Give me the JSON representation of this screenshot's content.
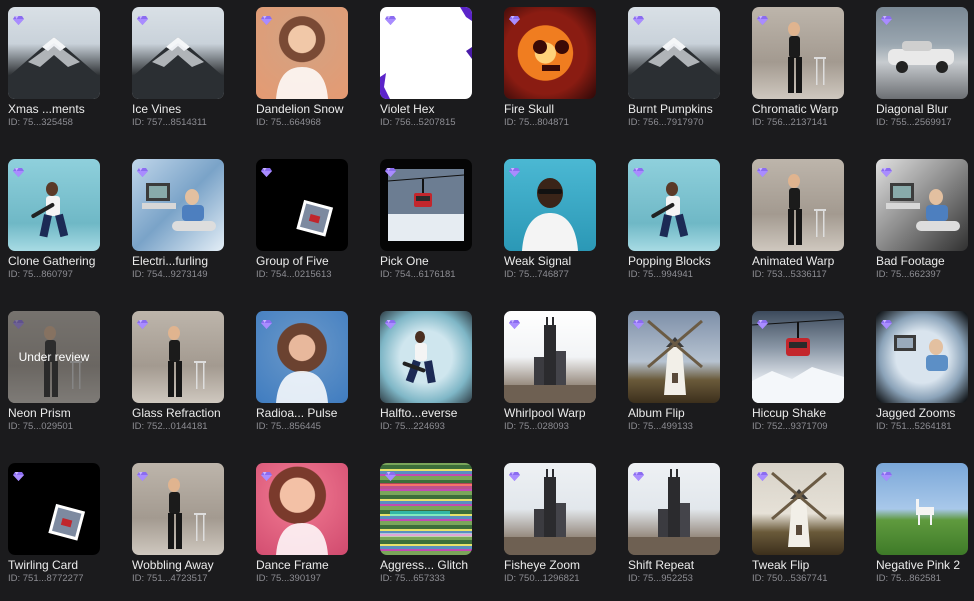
{
  "badge_color": "#8b6cf0",
  "items": [
    {
      "title": "Xmas ...ments",
      "id": "ID: 75...325458",
      "art": "mountain",
      "review": ""
    },
    {
      "title": "Ice Vines",
      "id": "ID: 757...8514311",
      "art": "mountain",
      "review": ""
    },
    {
      "title": "Dandelion Snow",
      "id": "ID: 75...664968",
      "art": "portrait",
      "review": ""
    },
    {
      "title": "Violet Hex",
      "id": "ID: 756...5207815",
      "art": "violet",
      "review": ""
    },
    {
      "title": "Fire Skull",
      "id": "ID: 75...804871",
      "art": "fire",
      "review": ""
    },
    {
      "title": "Burnt Pumpkins",
      "id": "ID: 756...7917970",
      "art": "mountain",
      "review": ""
    },
    {
      "title": "Chromatic Warp",
      "id": "ID: 756...2137141",
      "art": "studio",
      "review": ""
    },
    {
      "title": "Diagonal Blur",
      "id": "ID: 755...2569917",
      "art": "car",
      "review": ""
    },
    {
      "title": "Clone Gathering",
      "id": "ID: 75...860797",
      "art": "teal",
      "review": ""
    },
    {
      "title": "Electri...furling",
      "id": "ID: 754...9273149",
      "art": "bluecollage",
      "review": ""
    },
    {
      "title": "Group of Five",
      "id": "ID: 754...0215613",
      "art": "black",
      "review": ""
    },
    {
      "title": "Pick One",
      "id": "ID: 754...6176181",
      "art": "gondolaframe",
      "review": ""
    },
    {
      "title": "Weak Signal",
      "id": "ID: 75...746877",
      "art": "weak",
      "review": ""
    },
    {
      "title": "Popping Blocks",
      "id": "ID: 75...994941",
      "art": "teal",
      "review": ""
    },
    {
      "title": "Animated Warp",
      "id": "ID: 753...5336117",
      "art": "studio",
      "review": ""
    },
    {
      "title": "Bad Footage",
      "id": "ID: 75...662397",
      "art": "bw",
      "review": ""
    },
    {
      "title": "Neon Prism",
      "id": "ID: 75...029501",
      "art": "studio",
      "review": "Under review"
    },
    {
      "title": "Glass Refraction",
      "id": "ID: 752...0144181",
      "art": "studio",
      "review": ""
    },
    {
      "title": "Radioa... Pulse",
      "id": "ID: 75...856445",
      "art": "blueportrait",
      "review": ""
    },
    {
      "title": "Halfto...everse",
      "id": "ID: 75...224693",
      "art": "halftone",
      "review": ""
    },
    {
      "title": "Whirlpool Warp",
      "id": "ID: 75...028093",
      "art": "tower",
      "review": ""
    },
    {
      "title": "Album Flip",
      "id": "ID: 75...499133",
      "art": "windmill",
      "review": ""
    },
    {
      "title": "Hiccup Shake",
      "id": "ID: 752...9371709",
      "art": "gondola",
      "review": ""
    },
    {
      "title": "Jagged Zooms",
      "id": "ID: 751...5264181",
      "art": "vignette",
      "review": ""
    },
    {
      "title": "Twirling Card",
      "id": "ID: 751...8772277",
      "art": "black",
      "review": ""
    },
    {
      "title": "Wobbling Away",
      "id": "ID: 751...4723517",
      "art": "studio",
      "review": ""
    },
    {
      "title": "Dance Frame",
      "id": "ID: 75...390197",
      "art": "pink",
      "review": ""
    },
    {
      "title": "Aggress... Glitch",
      "id": "ID: 75...657333",
      "art": "glitch",
      "review": ""
    },
    {
      "title": "Fisheye Zoom",
      "id": "ID: 750...1296821",
      "art": "tower2",
      "review": ""
    },
    {
      "title": "Shift Repeat",
      "id": "ID: 75...952253",
      "art": "tower2",
      "review": ""
    },
    {
      "title": "Tweak Flip",
      "id": "ID: 750...5367741",
      "art": "windmill2",
      "review": ""
    },
    {
      "title": "Negative Pink 2",
      "id": "ID: 75...862581",
      "art": "grass",
      "review": ""
    }
  ]
}
